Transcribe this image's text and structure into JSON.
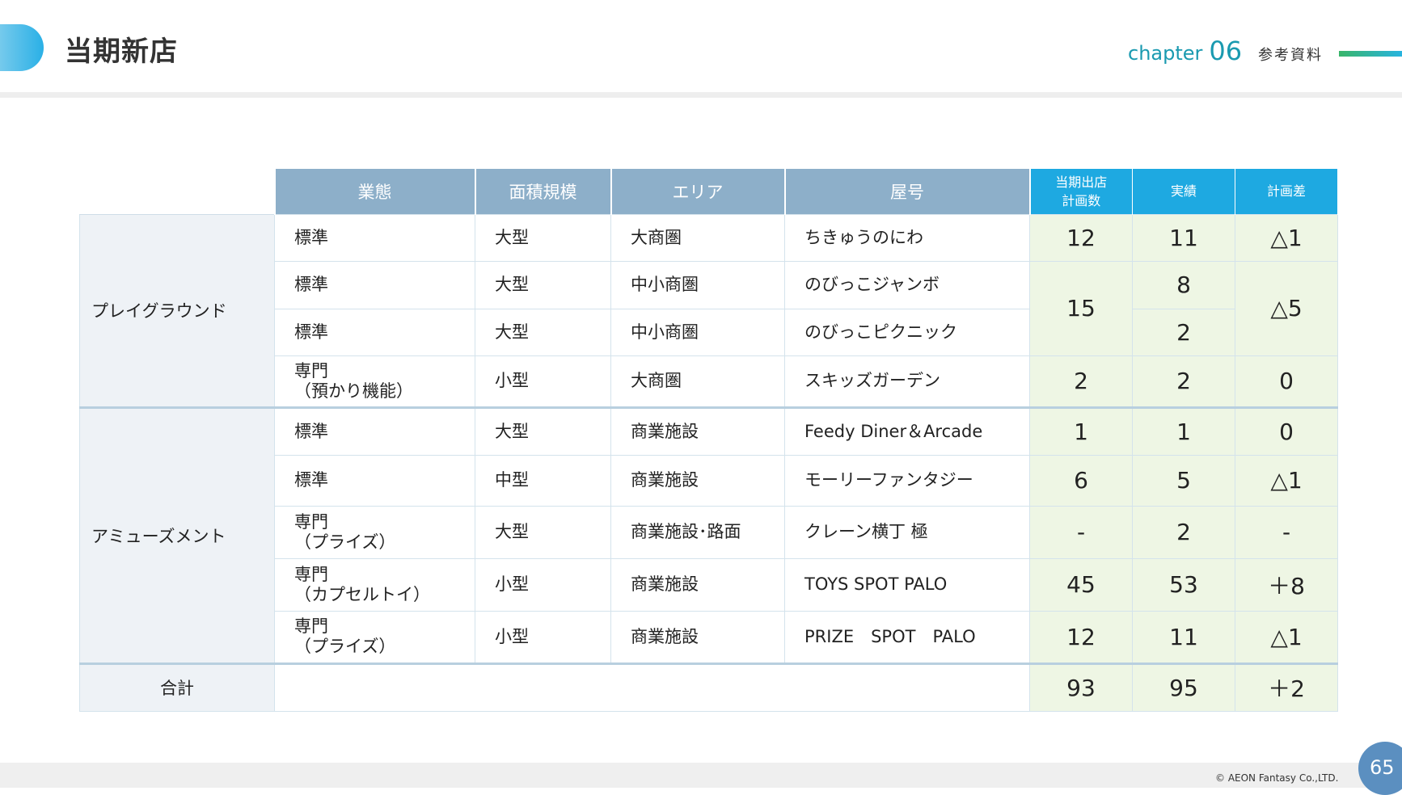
{
  "header": {
    "title": "当期新店",
    "chapter_label": "chapter",
    "chapter_number": "06",
    "section_label": "参考資料"
  },
  "table": {
    "headers": {
      "business_type": "業態",
      "area_scale": "面積規模",
      "area": "エリア",
      "store_name": "屋号",
      "plan_line1": "当期出店",
      "plan_line2": "計画数",
      "actual": "実績",
      "difference": "計画差"
    },
    "groups": {
      "playground": "プレイグラウンド",
      "amusement": "アミューズメント"
    },
    "rows": [
      {
        "type": "標準",
        "type2": "",
        "scale": "大型",
        "area": "大商圏",
        "name": "ちきゅうのにわ",
        "plan": "12",
        "actual": "11",
        "diff": "△1"
      },
      {
        "type": "標準",
        "type2": "",
        "scale": "大型",
        "area": "中小商圏",
        "name": "のびっこジャンボ",
        "plan": "15",
        "actual": "8",
        "diff": "△5"
      },
      {
        "type": "標準",
        "type2": "",
        "scale": "大型",
        "area": "中小商圏",
        "name": "のびっこピクニック",
        "plan": "",
        "actual": "2",
        "diff": ""
      },
      {
        "type": "専門",
        "type2": "（預かり機能）",
        "scale": "小型",
        "area": "大商圏",
        "name": "スキッズガーデン",
        "plan": "2",
        "actual": "2",
        "diff": "0"
      },
      {
        "type": "標準",
        "type2": "",
        "scale": "大型",
        "area": "商業施設",
        "name": "Feedy Diner＆Arcade",
        "plan": "1",
        "actual": "1",
        "diff": "0"
      },
      {
        "type": "標準",
        "type2": "",
        "scale": "中型",
        "area": "商業施設",
        "name": "モーリーファンタジー",
        "plan": "6",
        "actual": "5",
        "diff": "△1"
      },
      {
        "type": "専門",
        "type2": "（プライズ）",
        "scale": "大型",
        "area": "商業施設･路面",
        "name": "クレーン横丁 極",
        "plan": "-",
        "actual": "2",
        "diff": "-"
      },
      {
        "type": "専門",
        "type2": "（カプセルトイ）",
        "scale": "小型",
        "area": "商業施設",
        "name": "TOYS SPOT PALO",
        "plan": "45",
        "actual": "53",
        "diff": "＋8"
      },
      {
        "type": "専門",
        "type2": "（プライズ）",
        "scale": "小型",
        "area": "商業施設",
        "name": "PRIZE　SPOT　PALO",
        "plan": "12",
        "actual": "11",
        "diff": "△1"
      }
    ],
    "total": {
      "label": "合計",
      "plan": "93",
      "actual": "95",
      "diff": "＋2"
    }
  },
  "footer": {
    "copyright": "© AEON Fantasy Co.,LTD.",
    "page_number": "65"
  },
  "colors": {
    "header_grey": "#8dafc9",
    "header_blue": "#1ea9e1",
    "number_cell_bg": "#eef6e4",
    "group_cell_bg": "#eef2f6",
    "chapter_teal": "#1a9ab0",
    "page_badge": "#5b8fc0"
  }
}
